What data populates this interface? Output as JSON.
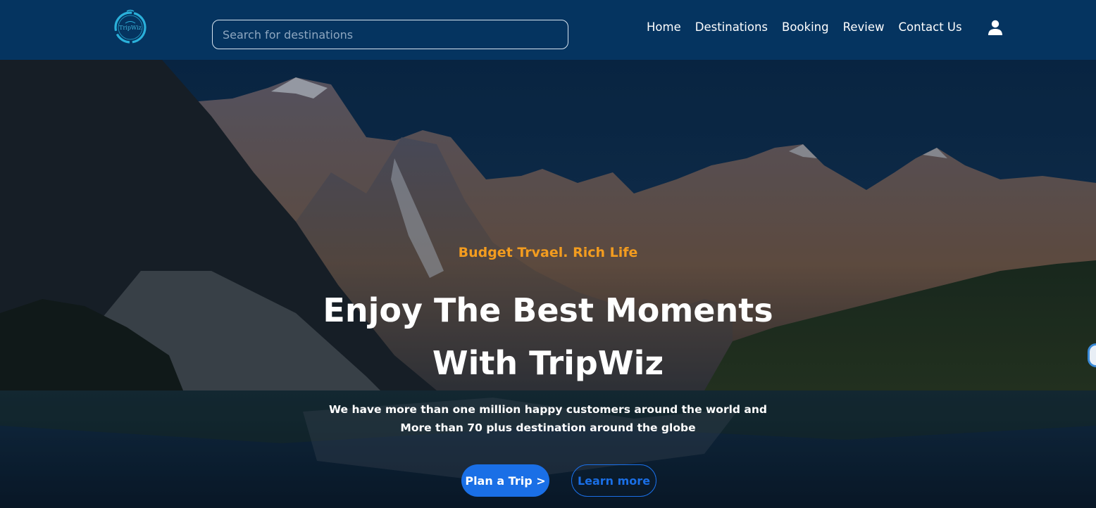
{
  "brand": {
    "logo_text": "TripWiz",
    "accent": "#3fb3d8"
  },
  "header": {
    "background": "#053460",
    "search": {
      "placeholder": "Search for destinations",
      "value": ""
    },
    "nav": [
      "Home",
      "Destinations",
      "Booking",
      "Review",
      "Contact Us"
    ],
    "user_icon": "user-icon"
  },
  "hero": {
    "tagline": "Budget Trvael. Rich Life",
    "headline_line1": "Enjoy The Best Moments",
    "headline_line2": "With TripWiz",
    "desc_line1": "We have more than one million happy customers around the world and",
    "desc_line2": "More than 70 plus destination around the globe",
    "primary_button": "Plan a Trip >",
    "secondary_button": "Learn more",
    "colors": {
      "tagline": "#f39c1f",
      "button": "#1a6fe6"
    }
  }
}
